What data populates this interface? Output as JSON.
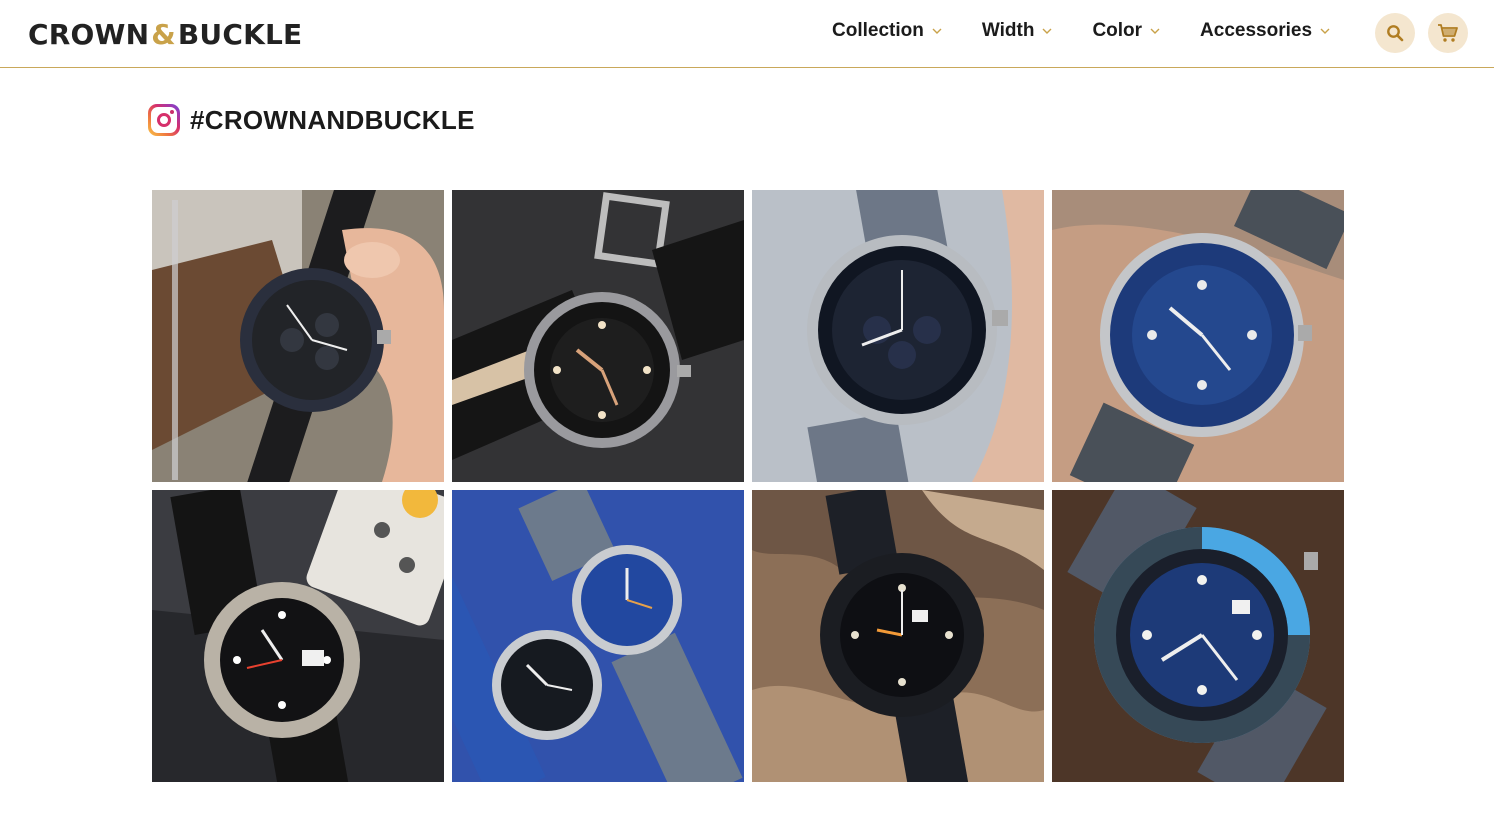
{
  "brand": {
    "name_left": "CROWN",
    "ampersand": "&",
    "name_right": "BUCKLE",
    "accent_color": "#c9a24a"
  },
  "nav": {
    "items": [
      {
        "label": "Collection",
        "icon": "chevron-down-icon"
      },
      {
        "label": "Width",
        "icon": "chevron-down-icon"
      },
      {
        "label": "Color",
        "icon": "chevron-down-icon"
      },
      {
        "label": "Accessories",
        "icon": "chevron-down-icon"
      }
    ],
    "search_icon": "search-icon",
    "cart_icon": "cart-icon",
    "icon_bg_color": "#f4e6cf"
  },
  "instagram": {
    "icon": "instagram-icon",
    "hashtag": "#CROWNANDBUCKLE"
  },
  "gallery": {
    "photos": [
      {
        "subject": "black strap chronograph watch held in hand",
        "icon": "watch-photo"
      },
      {
        "subject": "black diver watch with black and beige strap",
        "icon": "watch-photo"
      },
      {
        "subject": "chronograph watch on grey strap",
        "icon": "watch-photo"
      },
      {
        "subject": "blue bezel diver watch on wrist",
        "icon": "watch-photo"
      },
      {
        "subject": "GMT watch on black strap with remote control",
        "icon": "watch-photo"
      },
      {
        "subject": "two watches on blue and grey straps",
        "icon": "watch-photo"
      },
      {
        "subject": "black diver watch on rope",
        "icon": "watch-photo"
      },
      {
        "subject": "blue dial diver watch on grey strap",
        "icon": "watch-photo"
      }
    ]
  }
}
